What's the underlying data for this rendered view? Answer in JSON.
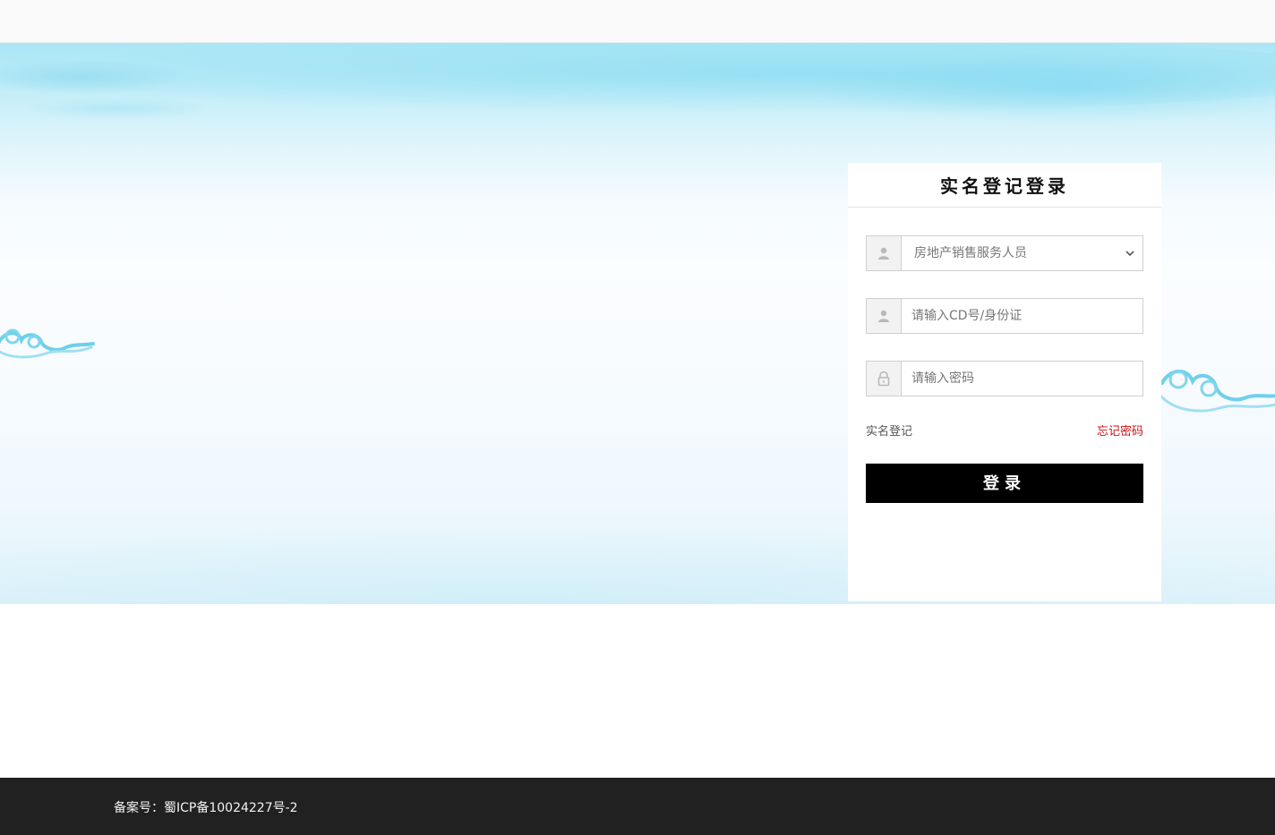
{
  "login": {
    "title": "实名登记登录",
    "role_select": {
      "selected": "房地产销售服务人员"
    },
    "id_field": {
      "placeholder": "请输入CD号/身份证"
    },
    "password_field": {
      "placeholder": "请输入密码"
    },
    "register_link": "实名登记",
    "forgot_link": "忘记密码",
    "submit_label": "登录"
  },
  "footer": {
    "icp": "备案号：蜀ICP备10024227号-2"
  },
  "colors": {
    "accent": "#000000",
    "forgot_link": "#cc1111",
    "footer_bg": "#212121"
  },
  "icons": [
    "user-icon",
    "user-icon",
    "lock-icon",
    "chevron-down-icon"
  ]
}
